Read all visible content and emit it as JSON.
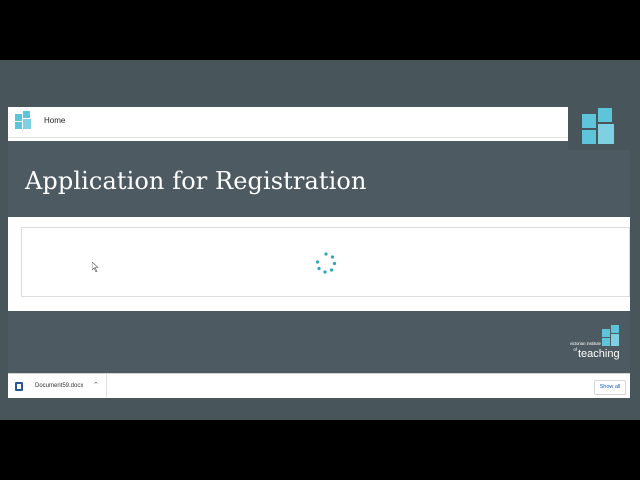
{
  "header": {
    "home_label": "Home"
  },
  "page": {
    "title": "Application for Registration"
  },
  "branding": {
    "line1": "victorian institute",
    "line2": "of",
    "line3": "teaching",
    "accent_color": "#5ec4d9",
    "dark_accent_color": "#2c8fb5"
  },
  "downloads_bar": {
    "file_name": "Document59.docx",
    "file_icon": "word-doc-icon",
    "show_all_label": "Show all"
  },
  "status": {
    "loading": true
  }
}
